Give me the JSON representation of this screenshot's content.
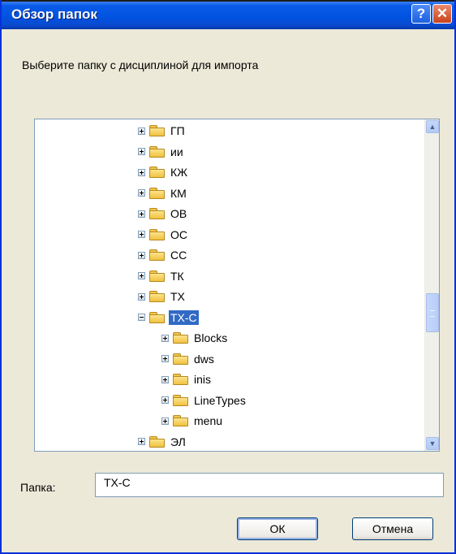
{
  "window": {
    "title": "Обзор папок",
    "help_label": "?",
    "close_label": "✕"
  },
  "prompt": "Выберите папку с дисциплиной для импорта",
  "tree": {
    "items": [
      {
        "label": "ГП",
        "expander": "plus",
        "selected": false
      },
      {
        "label": "ии",
        "expander": "plus",
        "selected": false
      },
      {
        "label": "КЖ",
        "expander": "plus",
        "selected": false
      },
      {
        "label": "КМ",
        "expander": "plus",
        "selected": false
      },
      {
        "label": "ОВ",
        "expander": "plus",
        "selected": false
      },
      {
        "label": "ОС",
        "expander": "plus",
        "selected": false
      },
      {
        "label": "СС",
        "expander": "plus",
        "selected": false
      },
      {
        "label": "ТК",
        "expander": "plus",
        "selected": false
      },
      {
        "label": "ТХ",
        "expander": "plus",
        "selected": false
      },
      {
        "label": "ТХ-С",
        "expander": "minus",
        "selected": true
      },
      {
        "label": "Blocks",
        "expander": "plus",
        "selected": false
      },
      {
        "label": "dws",
        "expander": "plus",
        "selected": false
      },
      {
        "label": "inis",
        "expander": "plus",
        "selected": false
      },
      {
        "label": "LineTypes",
        "expander": "plus",
        "selected": false
      },
      {
        "label": "menu",
        "expander": "plus",
        "selected": false
      },
      {
        "label": "ЭЛ",
        "expander": "plus",
        "selected": false
      }
    ],
    "scroll_position": 0.55
  },
  "folder": {
    "label": "Папка:",
    "value": "ТХ-С"
  },
  "buttons": {
    "ok": "ОК",
    "cancel": "Отмена"
  },
  "colors": {
    "titlebar": "#0053e1",
    "selection": "#316ac5",
    "dialog_bg": "#ece9d8"
  }
}
